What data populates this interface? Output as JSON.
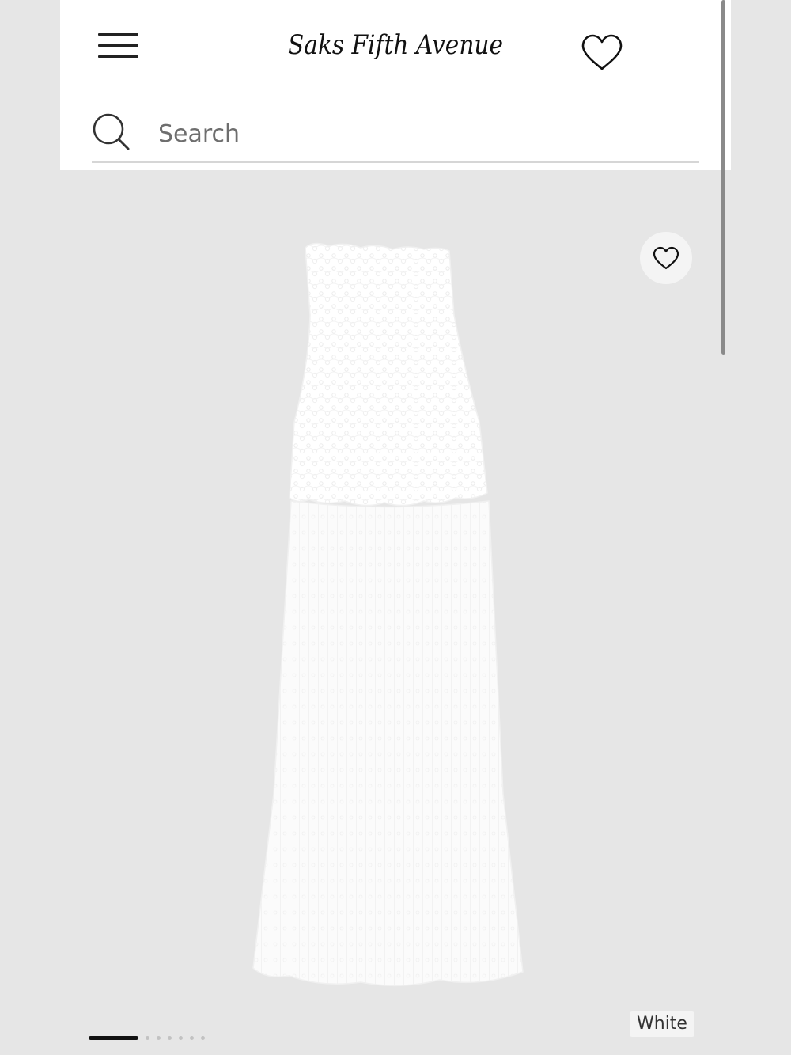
{
  "header": {
    "logo_text": "Saks Fifth Avenue"
  },
  "search": {
    "placeholder": "Search"
  },
  "product": {
    "image_alt": "White strapless lace dress",
    "color_label": "White",
    "image_count": 7,
    "current_image_index": 1
  },
  "icons": {
    "menu": "hamburger-menu-icon",
    "favorite": "heart-icon",
    "search": "magnifier-icon"
  },
  "colors": {
    "gallery_background": "#e6e6e6",
    "header_background": "#ffffff",
    "active_dot": "#111111",
    "inactive_dot": "#c2c2c2"
  }
}
